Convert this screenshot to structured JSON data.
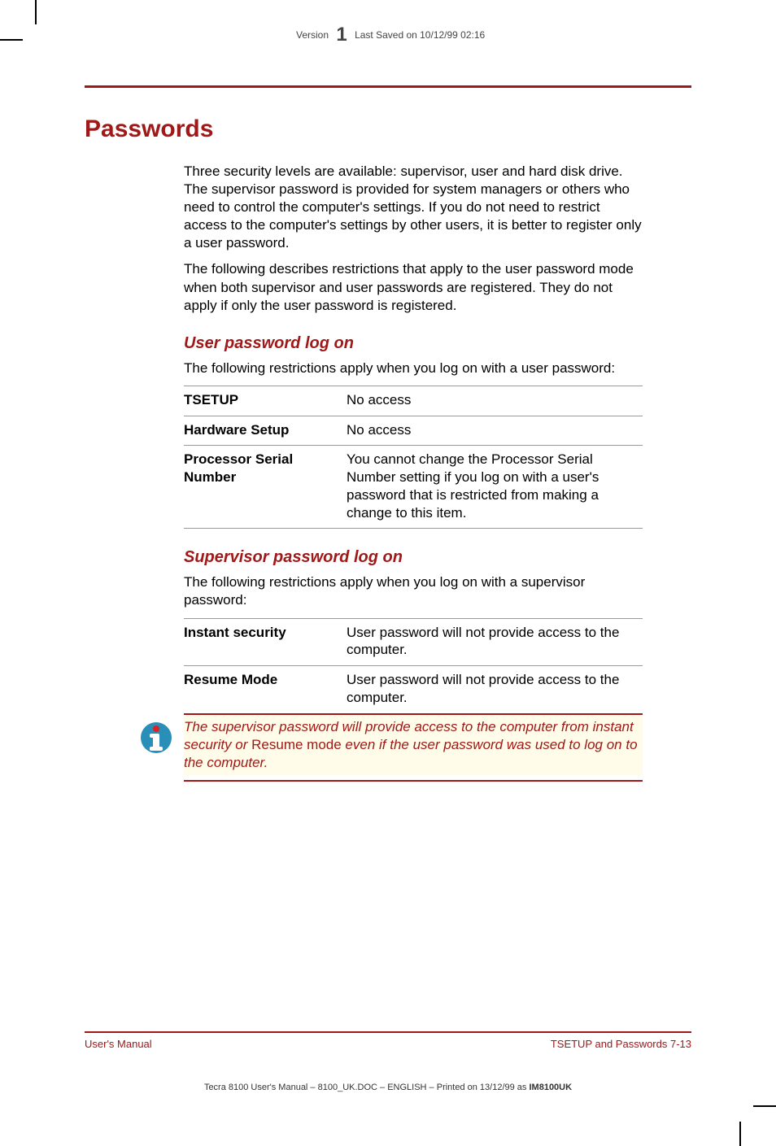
{
  "meta": {
    "version_label": "Version",
    "version_num": "1",
    "saved": "Last Saved on 10/12/99 02:16"
  },
  "title": "Passwords",
  "intro1": "Three security levels are available: supervisor, user and hard disk drive. The supervisor password is provided for system managers or others who need to control the computer's settings. If you do not need to restrict access to the computer's settings by other users, it is better to register only a user password.",
  "intro2": "The following describes restrictions that apply to the user password mode when both supervisor and user passwords are registered. They do not apply if only the user password is registered.",
  "user_section": {
    "heading": "User password log on",
    "intro": "The following restrictions apply when you log on with a user password:",
    "rows": [
      {
        "term": "TSETUP",
        "desc": "No access"
      },
      {
        "term": "Hardware Setup",
        "desc": "No access"
      },
      {
        "term": "Processor Serial Number",
        "desc": "You cannot change the Processor Serial Number setting if you log on with a user's password that is restricted from making a change to this item."
      }
    ]
  },
  "sup_section": {
    "heading": "Supervisor password log on",
    "intro": "The following restrictions apply when you log on with a supervisor password:",
    "rows": [
      {
        "term": "Instant security",
        "desc": "User password will not provide access to the computer."
      },
      {
        "term": "Resume Mode",
        "desc": "User password will not provide access to the computer."
      }
    ]
  },
  "note": {
    "part1": "The supervisor password will provide access to the computer from instant security or ",
    "roman": "Resume mode",
    "part2": " even if the user password was used to log on to the computer."
  },
  "footer": {
    "left": "User's Manual",
    "right": "TSETUP and Passwords  7-13"
  },
  "print": {
    "prefix": "Tecra 8100 User's Manual  – 8100_UK.DOC – ENGLISH – Printed on 13/12/99 as ",
    "bold": "IM8100UK"
  }
}
